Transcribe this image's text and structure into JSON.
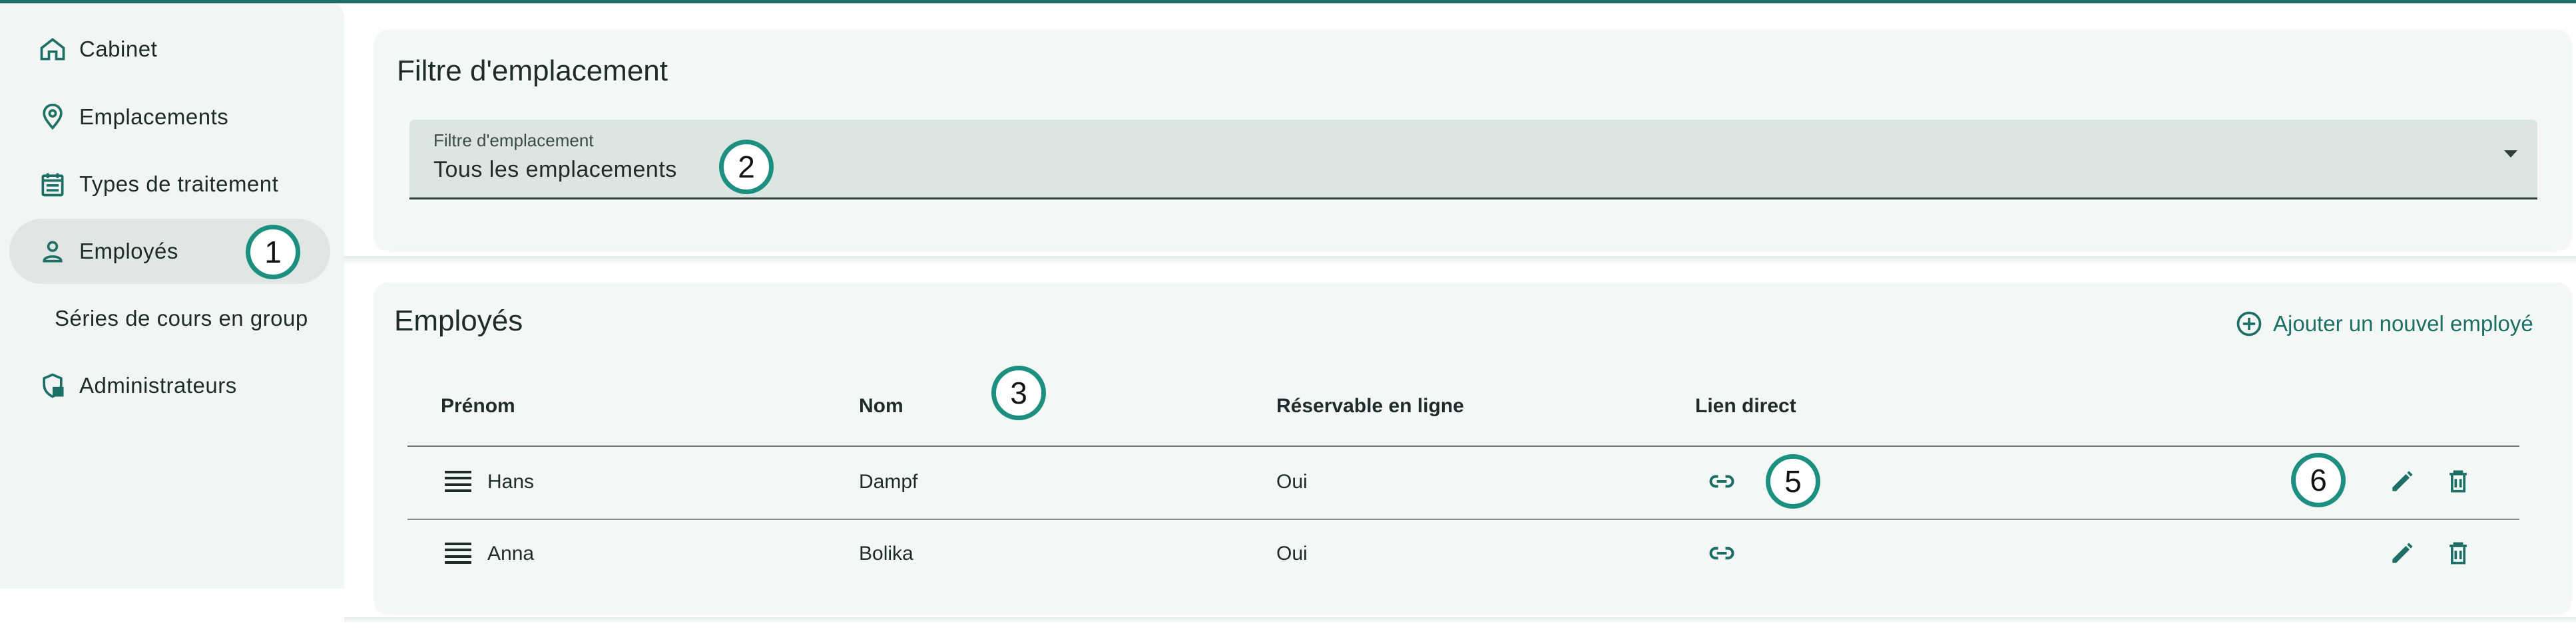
{
  "sidebar": {
    "items": [
      {
        "label": "Cabinet",
        "icon": "home-icon"
      },
      {
        "label": "Emplacements",
        "icon": "location-pin-icon"
      },
      {
        "label": "Types de traitement",
        "icon": "calendar-list-icon"
      },
      {
        "label": "Employés",
        "icon": "person-icon",
        "active": true
      },
      {
        "label": "Séries de cours en group",
        "icon": ""
      },
      {
        "label": "Administrateurs",
        "icon": "shield-lock-icon"
      }
    ]
  },
  "filter_card": {
    "title": "Filtre d'emplacement",
    "select_label": "Filtre d'emplacement",
    "select_value": "Tous les emplacements"
  },
  "employees_card": {
    "title": "Employés",
    "add_button": "Ajouter un nouvel employé",
    "columns": [
      "Prénom",
      "Nom",
      "Réservable en ligne",
      "Lien direct"
    ],
    "rows": [
      {
        "first_name": "Hans",
        "last_name": "Dampf",
        "bookable": "Oui"
      },
      {
        "first_name": "Anna",
        "last_name": "Bolika",
        "bookable": "Oui"
      }
    ]
  },
  "markers": [
    "1",
    "2",
    "3",
    "5",
    "6"
  ],
  "colors": {
    "accent": "#1d6e64",
    "sidebar_bg": "#f1f5f4",
    "card_bg": "#f3f7f6",
    "select_bg": "#dbe5e2",
    "marker_ring": "#1d8f80"
  }
}
